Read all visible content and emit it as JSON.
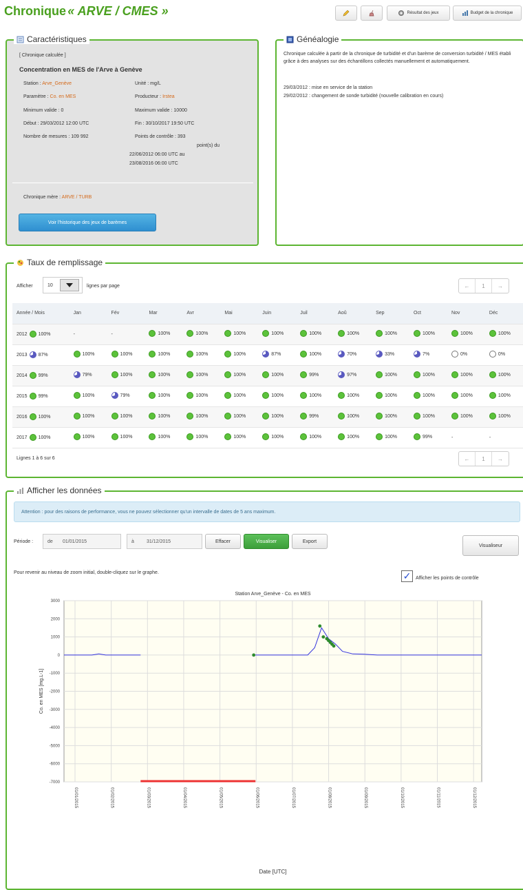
{
  "page": {
    "title_prefix": "Chronique",
    "title_em": "« ARVE / CMES »"
  },
  "toolbar": {
    "btn3_label": "Résultat des jeux",
    "btn4_label": "Budget de la chronique"
  },
  "characteristics": {
    "legend": "Caractéristiques",
    "type": "[ Chronique calculée ]",
    "heading": "Concentration en MES de l'Arve à Genève",
    "station_label": "Station :",
    "station_value": "Arve_Genève",
    "unit": "Unité : mg/L",
    "param_label": "Paramètre :",
    "param_value": "Co. en MES",
    "producer_label": "Producteur :",
    "producer_value": "Irstea",
    "min_valid": "Minimum valide : 0",
    "max_valid": "Maximum valide : 10000",
    "start": "Début : 29/03/2012 12:00 UTC",
    "end": "Fin : 30/10/2017 19:50 UTC",
    "count": "Nombre de mesures : 109 992",
    "control_1": "Points de contrôle : 393",
    "control_2": "point(s) du",
    "control_3": "22/06/2012 06:00 UTC au",
    "control_4": "23/08/2016 06:00 UTC",
    "mother_label": "Chronique mère :",
    "mother_value": "ARVE / TURB",
    "btn_history": "Voir l'historique des jeux de barèmes"
  },
  "genealogy": {
    "legend": "Généalogie",
    "text": "Chronique calculée à partir de la chronique de turbidité et d'un barème de conversion turbidité / MES établi grâce à des analyses sur des échantillons collectés manuellement et automatiquement.",
    "entry1": "29/03/2012 : mise en service de la station",
    "entry2": "29/02/2012 : changement de sonde turbidité (nouvelle calibration en cours)"
  },
  "taux": {
    "legend": "Taux de remplissage",
    "show_label": "Afficher",
    "per_page_value": "10",
    "per_page_suffix": "lignes par page",
    "header_year": "Année / Mois",
    "months": [
      "Jan",
      "Fév",
      "Mar",
      "Avr",
      "Mai",
      "Juin",
      "Juil",
      "Aoû",
      "Sep",
      "Oct",
      "Nov",
      "Déc"
    ],
    "rows": [
      {
        "year": "2012",
        "total": "100%",
        "cells": [
          "-",
          "-",
          "100%",
          "100%",
          "100%",
          "100%",
          "100%",
          "100%",
          "100%",
          "100%",
          "100%",
          "100%"
        ]
      },
      {
        "year": "2013",
        "total": "87%",
        "cells": [
          "100%",
          "100%",
          "100%",
          "100%",
          "100%",
          "87%",
          "100%",
          "70%",
          "33%",
          "7%",
          "0%",
          "0%"
        ]
      },
      {
        "year": "2014",
        "total": "99%",
        "cells": [
          "79%",
          "100%",
          "100%",
          "100%",
          "100%",
          "100%",
          "99%",
          "97%",
          "100%",
          "100%",
          "100%",
          "100%"
        ]
      },
      {
        "year": "2015",
        "total": "99%",
        "cells": [
          "100%",
          "79%",
          "100%",
          "100%",
          "100%",
          "100%",
          "100%",
          "100%",
          "100%",
          "100%",
          "100%",
          "100%"
        ]
      },
      {
        "year": "2016",
        "total": "100%",
        "cells": [
          "100%",
          "100%",
          "100%",
          "100%",
          "100%",
          "100%",
          "99%",
          "100%",
          "100%",
          "100%",
          "100%",
          "100%"
        ]
      },
      {
        "year": "2017",
        "total": "100%",
        "cells": [
          "100%",
          "100%",
          "100%",
          "100%",
          "100%",
          "100%",
          "100%",
          "100%",
          "100%",
          "99%",
          "-",
          "-"
        ]
      }
    ],
    "footer": "Lignes 1 à 6 sur 6",
    "pager": [
      "←",
      "1",
      "→"
    ]
  },
  "data_section": {
    "legend": "Afficher les données",
    "alert": "Attention : pour des raisons de performance, vous ne pouvez sélectionner qu'un intervalle de dates de 5 ans maximum.",
    "period_label": "Période :",
    "from_label": "de",
    "from_value": "01/01/2015",
    "to_label": "à",
    "to_value": "31/12/2015",
    "btn_clear": "Effacer",
    "btn_view": "Visualiser",
    "btn_export": "Export",
    "btn_viewer": "Visualiseur",
    "zoom_hint": "Pour revenir au niveau de zoom initial, double-cliquez sur le graphe.",
    "show_control": "Afficher les points de contrôle"
  },
  "chart_data": {
    "type": "line",
    "title": "Station Arve_Genève - Co. en MES",
    "xlabel": "Date [UTC]",
    "ylabel": "Co. en MES [mg.L-1]",
    "ylim": [
      -7000,
      3000
    ],
    "yticks": [
      "3000",
      "2000",
      "1000",
      "0",
      "-1000",
      "-2000",
      "-3000",
      "-4000",
      "-5000",
      "-6000",
      "-7000"
    ],
    "xticks": [
      "01/01/2015",
      "01/02/2015",
      "01/03/2015",
      "01/04/2015",
      "01/05/2015",
      "01/06/2015",
      "01/07/2015",
      "01/08/2015",
      "01/09/2015",
      "01/10/2015",
      "01/11/2015",
      "01/12/2015"
    ],
    "series": [
      {
        "x": [
          0.0,
          0.8,
          1.0,
          1.2,
          2.2
        ],
        "y": [
          0,
          0,
          60,
          0,
          0
        ]
      },
      {
        "x": [
          5.5,
          6.5,
          7.0,
          7.2,
          7.4,
          7.6,
          7.8,
          8.0,
          8.3,
          8.6,
          9.0,
          12.0
        ],
        "y": [
          0,
          0,
          0,
          400,
          1500,
          900,
          600,
          200,
          60,
          50,
          0,
          0
        ]
      }
    ],
    "control_points": {
      "x": [
        5.45,
        7.35,
        7.45,
        7.55,
        7.6,
        7.65,
        7.7,
        7.75
      ],
      "y": [
        0,
        1600,
        1000,
        900,
        800,
        700,
        600,
        500
      ]
    },
    "gap": {
      "from": 2.2,
      "to": 5.5
    },
    "colors": {
      "line": "#3333dd",
      "points": "#2e8b2e",
      "gap": "#ee3333",
      "grid": "#dddddd",
      "plot_bg": "#fffef2"
    }
  }
}
